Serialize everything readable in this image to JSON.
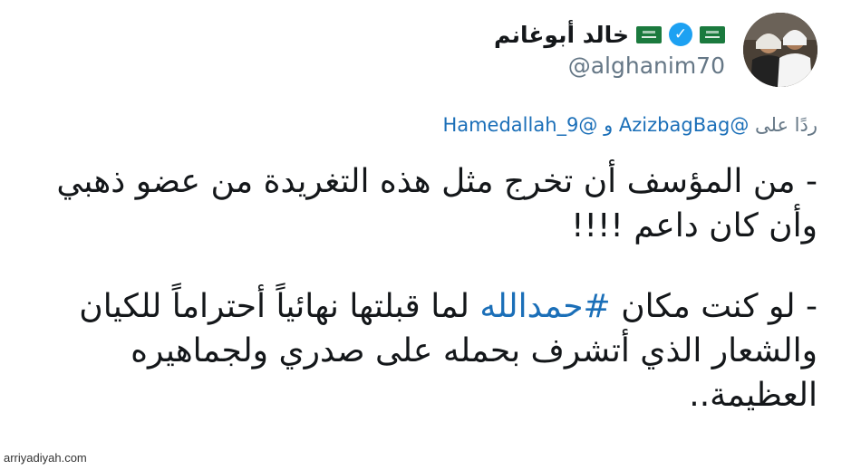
{
  "author": {
    "display_name": "خالد أبوغانم",
    "handle": "@alghanim70",
    "flag_icon": "saudi-flag-icon",
    "verified_icon": "verified-badge-icon",
    "verified_color": "#1da1f2"
  },
  "reply": {
    "prefix": "ردًا على",
    "mention_1": "@AzizbagBag",
    "conjunction": "و",
    "mention_2": "@Hamedallah_9"
  },
  "tweet": {
    "paragraph_1": {
      "line_1": "- من المؤسف أن تخرج مثل هذه التغريدة من عضو ذهبي",
      "line_2": "وأن كان داعم !!!!"
    },
    "paragraph_2": {
      "before_hashtag": "- لو كنت مكان",
      "hashtag": "#حمدالله",
      "after_hashtag": "لما قبلتها نهائياً أحتراماً للكيان",
      "line_2": "والشعار الذي أتشرف بحمله على صدري ولجماهيره",
      "line_3": "العظيمة.."
    }
  },
  "watermark": "arriyadiyah.com",
  "colors": {
    "link": "#1b6fb8",
    "secondary_text": "#657786",
    "flag_green": "#1b7a3e"
  }
}
